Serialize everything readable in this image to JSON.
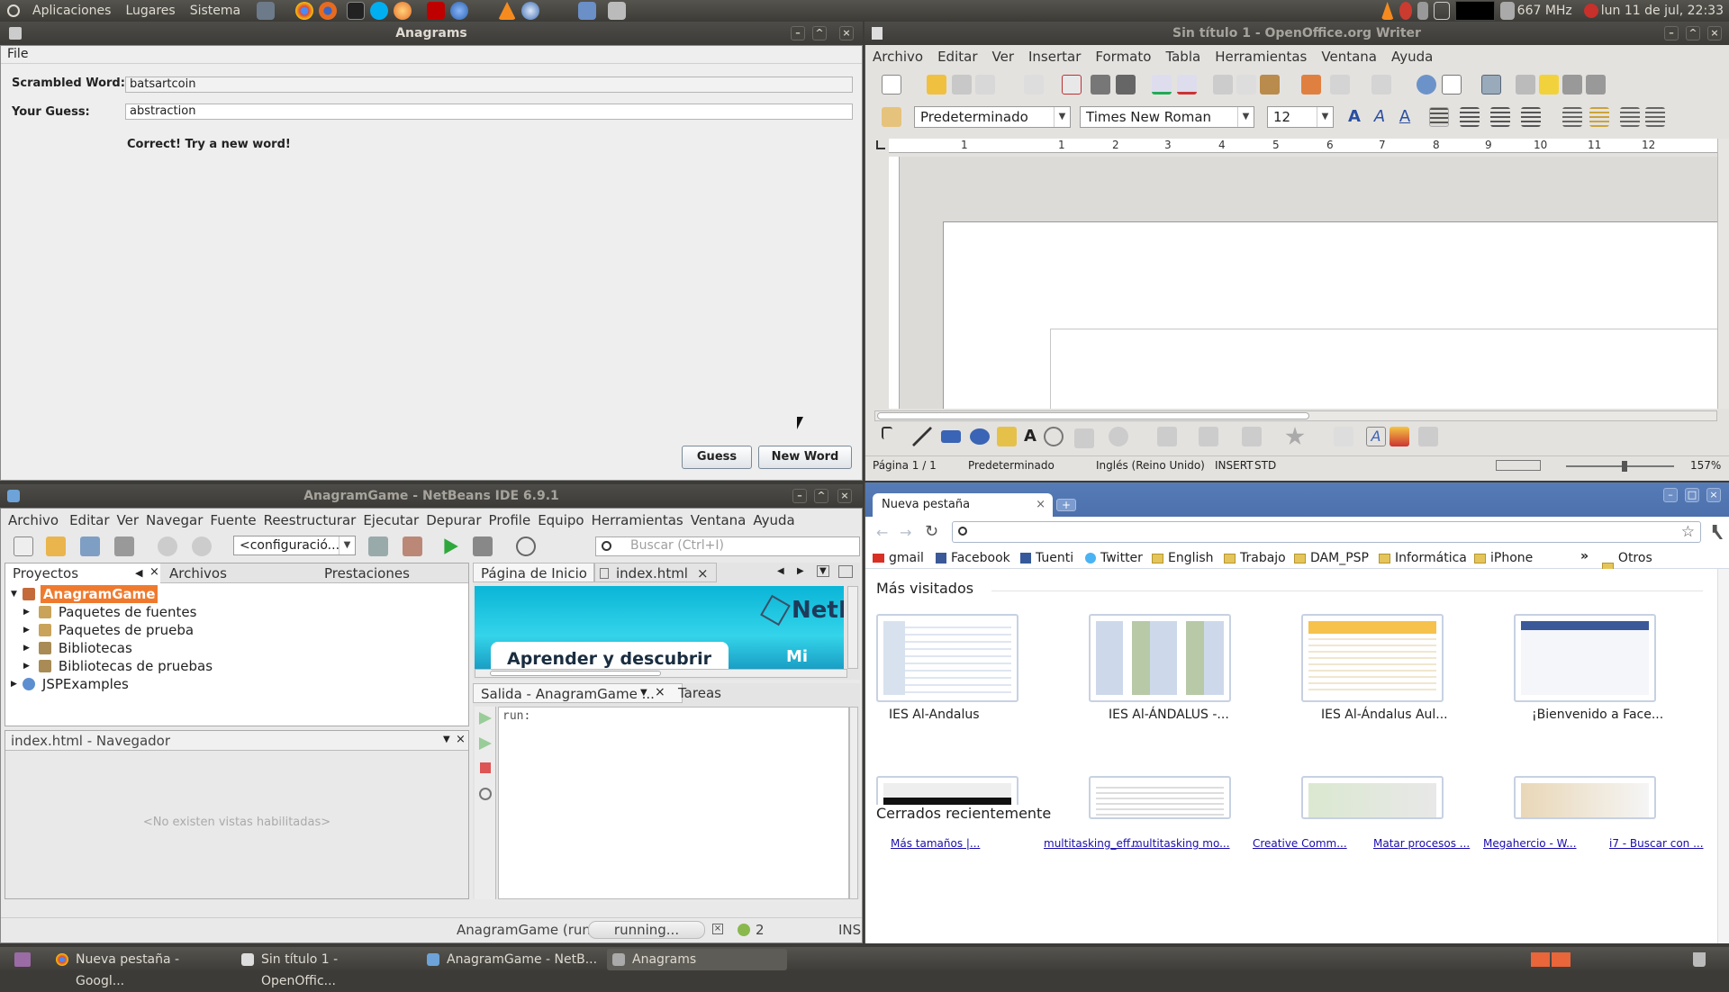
{
  "top_panel": {
    "menus": [
      "Aplicaciones",
      "Lugares",
      "Sistema"
    ],
    "cpu_freq": "667 MHz",
    "clock": "lun 11 de jul, 22:33"
  },
  "anagrams": {
    "title": "Anagrams",
    "menu_file": "File",
    "scrambled_label": "Scrambled Word:",
    "scrambled_value": "batsartcoin",
    "guess_label": "Your Guess:",
    "guess_value": "abstraction",
    "feedback": "Correct! Try a new word!",
    "guess_button": "Guess",
    "new_word_button": "New Word"
  },
  "writer": {
    "title": "Sin título 1 - OpenOffice.org Writer",
    "menu": [
      "Archivo",
      "Editar",
      "Ver",
      "Insertar",
      "Formato",
      "Tabla",
      "Herramientas",
      "Ventana",
      "Ayuda"
    ],
    "style_value": "Predeterminado",
    "font_value": "Times New Roman",
    "size_value": "12",
    "ruler_numbers": [
      "1",
      "1",
      "2",
      "3",
      "4",
      "5",
      "6",
      "7",
      "8",
      "9",
      "10",
      "11",
      "12"
    ],
    "status": {
      "page": "Página 1 / 1",
      "style": "Predeterminado",
      "lang": "Inglés (Reino Unido)",
      "mode": "INSERT",
      "sel": "STD",
      "zoom": "157%"
    }
  },
  "netbeans": {
    "title": "AnagramGame - NetBeans IDE 6.9.1",
    "menu": [
      "Archivo",
      "Editar",
      "Ver",
      "Navegar",
      "Fuente",
      "Reestructurar",
      "Ejecutar",
      "Depurar",
      "Profile",
      "Equipo",
      "Herramientas",
      "Ventana",
      "Ayuda"
    ],
    "config_combo": "<configuració...",
    "search_placeholder": "Buscar (Ctrl+I)",
    "project_tabs": [
      "Proyectos",
      "Archivos",
      "Prestaciones"
    ],
    "tree": {
      "root": "AnagramGame",
      "children": [
        "Paquetes de fuentes",
        "Paquetes de prueba",
        "Bibliotecas",
        "Bibliotecas de pruebas"
      ],
      "other": "JSPExamples"
    },
    "navigator_title": "index.html - Navegador",
    "navigator_empty": "<No existen vistas habilitadas>",
    "editor_tabs": [
      "Página de Inicio",
      "index.html"
    ],
    "start_page_text": "Aprender y descubrir",
    "start_page_right": "Mi Net",
    "start_page_logo": "NetB",
    "output_tabs": [
      "Salida - AnagramGame ...",
      "Tareas"
    ],
    "output_text": "run:",
    "status_run": "AnagramGame (run)",
    "status_progress": "running...",
    "status_count": "2",
    "status_mode": "INS"
  },
  "chrome": {
    "tab_title": "Nueva pestaña",
    "bookmarks": [
      "gmail",
      "Facebook",
      "Tuenti",
      "Twitter",
      "English",
      "Trabajo",
      "DAM_PSP",
      "Informática",
      "iPhone"
    ],
    "other_bookmarks": "Otros marcadores",
    "most_visited_title": "Más visitados",
    "most_visited": [
      "IES Al-Andalus",
      "IES Al-ÁNDALUS -...",
      "IES Al-Ándalus Aul...",
      "¡Bienvenido a Face..."
    ],
    "recently_closed_title": "Cerrados recientemente",
    "recently_closed": [
      "Más tamaños |...",
      "multitasking_eff...",
      "multitasking mo...",
      "Creative Comm...",
      "Matar procesos ...",
      "Megahercio - W...",
      "i7 - Buscar con ..."
    ]
  },
  "taskbar": {
    "tasks": [
      "Nueva pestaña - Googl...",
      "Sin título 1 - OpenOffic...",
      "AnagramGame - NetB...",
      "Anagrams"
    ]
  },
  "colors": {
    "ubuntu_panel": "#3c3b37",
    "netbeans_selection": "#ef7a2e",
    "chrome_frame": "#4a6fa5"
  }
}
